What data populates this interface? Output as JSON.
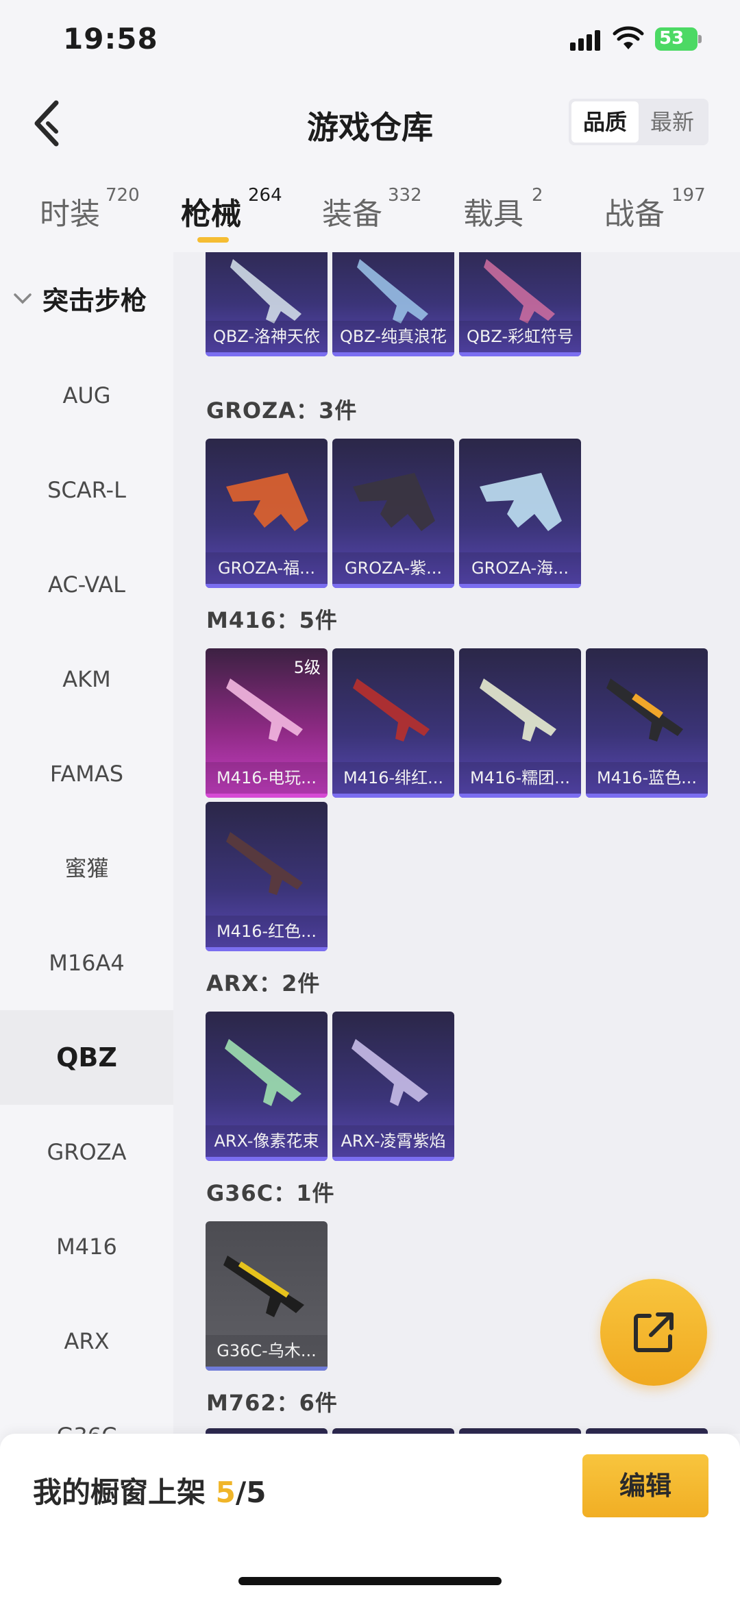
{
  "status_bar": {
    "time": "19:58",
    "battery": "53"
  },
  "header": {
    "title": "游戏仓库",
    "sort_options": [
      "品质",
      "最新"
    ],
    "active_sort": "品质"
  },
  "tabs": [
    {
      "label": "时装",
      "count": "720"
    },
    {
      "label": "枪械",
      "count": "264",
      "active": true
    },
    {
      "label": "装备",
      "count": "332"
    },
    {
      "label": "载具",
      "count": "2"
    },
    {
      "label": "战备",
      "count": "197"
    }
  ],
  "sidebar": {
    "header": "突击步枪",
    "items": [
      "AUG",
      "SCAR-L",
      "AC-VAL",
      "AKM",
      "FAMAS",
      "蜜獾",
      "M16A4",
      "QBZ",
      "GROZA",
      "M416",
      "ARX",
      "G36C"
    ],
    "active": "QBZ"
  },
  "groups": {
    "qbz": {
      "items": [
        "QBZ-洛神天依",
        "QBZ-纯真浪花",
        "QBZ-彩虹符号"
      ]
    },
    "groza": {
      "title": "GROZA：3件",
      "items": [
        "GROZA-福...",
        "GROZA-紫...",
        "GROZA-海..."
      ]
    },
    "m416": {
      "title": "M416：5件",
      "level_badge": "5级",
      "items": [
        "M416-电玩...",
        "M416-绯红...",
        "M416-糯团...",
        "M416-蓝色...",
        "M416-红色..."
      ]
    },
    "arx": {
      "title": "ARX：2件",
      "items": [
        "ARX-像素花束",
        "ARX-凌霄紫焰"
      ]
    },
    "g36c": {
      "title": "G36C：1件",
      "items": [
        "G36C-乌木..."
      ]
    },
    "m762": {
      "title": "M762：6件"
    }
  },
  "bottom_bar": {
    "label": "我的橱窗上架",
    "count_current": "5",
    "count_total": "/5",
    "edit_label": "编辑"
  },
  "icons": {
    "back": "chevron-left-icon",
    "share": "share-external-icon",
    "collapse": "chevron-down-icon"
  },
  "colors": {
    "accent": "#f5bd33",
    "card_bottom": "#5a49b6",
    "legendary_pink": "#c840c6"
  }
}
